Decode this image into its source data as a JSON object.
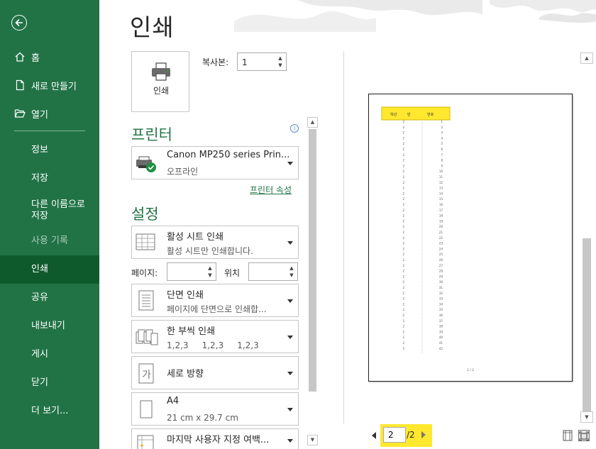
{
  "sidebar": {
    "top_items": [
      {
        "label": "홈"
      },
      {
        "label": "새로 만들기"
      },
      {
        "label": "열기"
      }
    ],
    "items": [
      {
        "label": "정보"
      },
      {
        "label": "저장"
      },
      {
        "label_line1": "다른 이름으로",
        "label_line2": "저장"
      },
      {
        "label": "사용 기록"
      },
      {
        "label": "인쇄"
      },
      {
        "label": "공유"
      },
      {
        "label": "내보내기"
      },
      {
        "label": "게시"
      },
      {
        "label": "닫기"
      },
      {
        "label": "더 보기..."
      }
    ]
  },
  "page_title": "인쇄",
  "print_button": {
    "label": "인쇄"
  },
  "copies": {
    "label": "복사본:",
    "value": "1"
  },
  "printer": {
    "section_title": "프린터",
    "name": "Canon MP250 series Prin...",
    "status": "오프라인",
    "properties_link": "프린터 속성"
  },
  "settings": {
    "section_title": "설정",
    "what": {
      "title": "활성 시트 인쇄",
      "desc": "활성 시트만 인쇄합니다."
    },
    "pages_label": "페이지:",
    "pages_from": "",
    "pages_to_label": "위치",
    "pages_to": "",
    "sides": {
      "title": "단면 인쇄",
      "desc": "페이지에 단면으로 인쇄합..."
    },
    "collate": {
      "title": "한 부씩 인쇄",
      "desc": "1,2,3     1,2,3     1,2,3"
    },
    "orientation": {
      "title": "세로 방향"
    },
    "paper": {
      "title": "A4",
      "desc": "21 cm x 29.7 cm"
    },
    "margins": {
      "title": "마지막 사용자 지정 여백..."
    }
  },
  "preview": {
    "headers": [
      "학년",
      "반",
      "번호"
    ],
    "rows": [
      [
        "2",
        "1"
      ],
      [
        "2",
        "2"
      ],
      [
        "2",
        "3"
      ],
      [
        "2",
        "4"
      ],
      [
        "2",
        "5"
      ],
      [
        "2",
        "6"
      ],
      [
        "2",
        "7"
      ],
      [
        "2",
        "8"
      ],
      [
        "2",
        "9"
      ],
      [
        "2",
        "10"
      ],
      [
        "2",
        "11"
      ],
      [
        "2",
        "12"
      ],
      [
        "2",
        "13"
      ],
      [
        "2",
        "14"
      ],
      [
        "2",
        "15"
      ],
      [
        "2",
        "16"
      ],
      [
        "2",
        "17"
      ],
      [
        "2",
        "18"
      ],
      [
        "2",
        "19"
      ],
      [
        "2",
        "20"
      ],
      [
        "2",
        "21"
      ],
      [
        "2",
        "22"
      ],
      [
        "2",
        "23"
      ],
      [
        "2",
        "24"
      ],
      [
        "2",
        "25"
      ],
      [
        "2",
        "26"
      ],
      [
        "2",
        "27"
      ],
      [
        "2",
        "28"
      ],
      [
        "2",
        "29"
      ],
      [
        "2",
        "30"
      ],
      [
        "2",
        "31"
      ],
      [
        "2",
        "32"
      ],
      [
        "2",
        "33"
      ],
      [
        "2",
        "34"
      ],
      [
        "2",
        "35"
      ],
      [
        "2",
        "36"
      ],
      [
        "2",
        "37"
      ],
      [
        "2",
        "38"
      ],
      [
        "2",
        "39"
      ],
      [
        "2",
        "40"
      ],
      [
        "2",
        "41"
      ],
      [
        "2",
        "42"
      ]
    ],
    "footer": "2 / 2"
  },
  "pager": {
    "current": "2",
    "total": "/2"
  },
  "colors": {
    "sidebar": "#217346",
    "active": "#0f5a2d",
    "highlight": "#ffe82e",
    "accent": "#217346"
  }
}
